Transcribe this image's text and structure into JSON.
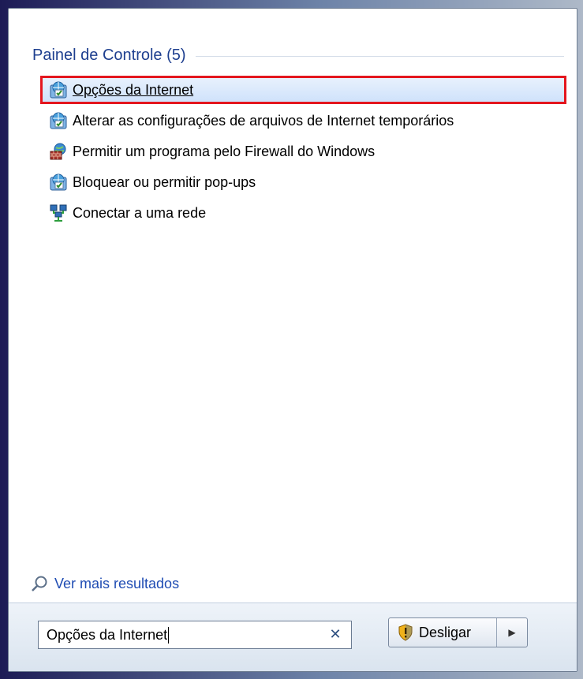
{
  "group": {
    "title": "Painel de Controle (5)"
  },
  "results": [
    {
      "label": "Opções da Internet",
      "icon": "internet-options-icon",
      "selected": true
    },
    {
      "label": "Alterar as configurações de arquivos de Internet temporários",
      "icon": "internet-options-icon",
      "selected": false
    },
    {
      "label": "Permitir um programa pelo Firewall do Windows",
      "icon": "firewall-icon",
      "selected": false
    },
    {
      "label": "Bloquear ou permitir pop-ups",
      "icon": "internet-options-icon",
      "selected": false
    },
    {
      "label": "Conectar a uma rede",
      "icon": "network-icon",
      "selected": false
    }
  ],
  "more_results": {
    "label": "Ver mais resultados",
    "icon": "search-icon"
  },
  "search": {
    "value": "Opções da Internet",
    "clear_icon": "close-icon"
  },
  "power": {
    "label": "Desligar",
    "icon": "shield-warning-icon",
    "arrow_icon": "chevron-right-icon"
  },
  "colors": {
    "header_text": "#1e3f8f",
    "link_text": "#1f4cb3",
    "highlight_border": "#e4161e"
  }
}
